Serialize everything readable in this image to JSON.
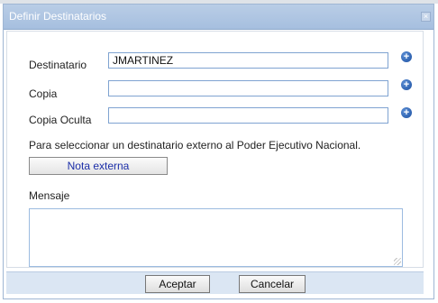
{
  "dialog": {
    "title": "Definir Destinatarios",
    "close_label": "×"
  },
  "form": {
    "destinatario": {
      "label": "Destinatario",
      "value": "JMARTINEZ",
      "placeholder": ""
    },
    "copia": {
      "label": "Copia",
      "value": "",
      "placeholder": ""
    },
    "copia_oculta": {
      "label": "Copia Oculta",
      "value": "",
      "placeholder": ""
    },
    "external_hint": "Para seleccionar un destinatario externo al Poder Ejecutivo Nacional.",
    "note_button": "Nota externa",
    "mensaje": {
      "label": "Mensaje",
      "value": ""
    },
    "add_icon_glyph": "+"
  },
  "footer": {
    "accept_label": "Aceptar",
    "cancel_label": "Cancelar"
  },
  "colors": {
    "titlebar": "#a6bfdf",
    "field_border": "#7fa3d1",
    "link_text": "#1c2fa8",
    "footer_bg": "#dbe6f3"
  },
  "icons": {
    "add": "plus-circle-icon",
    "close": "close-icon"
  }
}
